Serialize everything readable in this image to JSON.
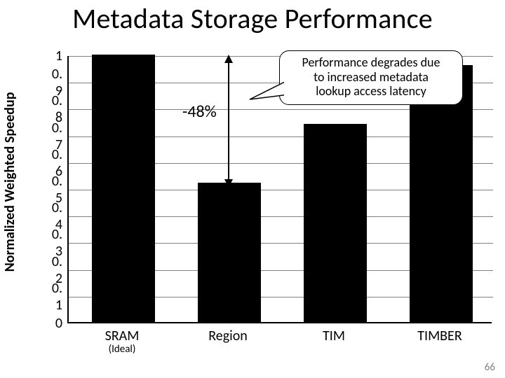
{
  "title": "Metadata Storage Performance",
  "ylabel": "Normalized Weighted Speedup",
  "annotation": "-48%",
  "callout": "Performance degrades due\nto increased metadata\nlookup access latency",
  "page_number": "66",
  "chart_data": {
    "type": "bar",
    "title": "Metadata Storage Performance",
    "xlabel": "",
    "ylabel": "Normalized Weighted Speedup",
    "ylim": [
      0,
      1
    ],
    "yticks": [
      0,
      0.1,
      0.2,
      0.3,
      0.4,
      0.5,
      0.6,
      0.7,
      0.8,
      0.9,
      1
    ],
    "ytick_labels": [
      "0",
      "0. 1",
      "0. 2",
      "0. 3",
      "0. 4",
      "0. 5",
      "0. 6",
      "0. 7",
      "0. 8",
      "0. 9",
      "1"
    ],
    "categories": [
      "SRAM",
      "Region",
      "TIM",
      "TIMBER"
    ],
    "category_sub": [
      "(Ideal)",
      "",
      "",
      ""
    ],
    "values": [
      1.0,
      0.52,
      0.74,
      0.96
    ],
    "annotations": [
      {
        "text": "-48%",
        "between": [
          "SRAM",
          "Region"
        ],
        "y_from": 1.0,
        "y_to": 0.52
      },
      {
        "text": "Performance degrades due to increased metadata lookup access latency",
        "type": "callout",
        "points_to": "Region"
      }
    ]
  }
}
